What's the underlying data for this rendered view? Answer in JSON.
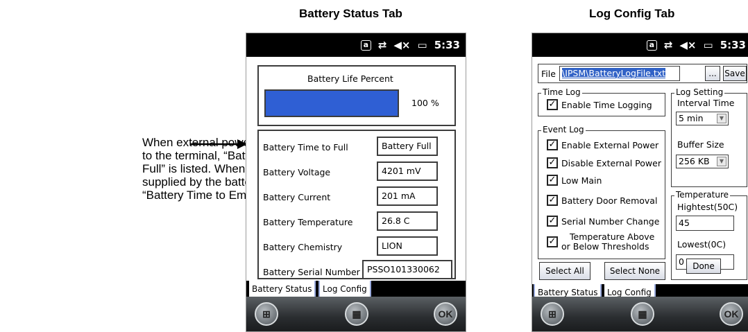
{
  "headings": {
    "battery_tab": "Battery Status Tab",
    "log_tab": "Log Config Tab"
  },
  "annotation": {
    "text": "When external power is supplied to the terminal, “Battery Time to Full” is listed. When power is supplied by the battery pack, “Battery Time to Empty” is listed."
  },
  "statusbar": {
    "time": "5:33",
    "icons": [
      "a-icon",
      "sync-icon",
      "mute-icon",
      "battery-icon"
    ]
  },
  "battery_screen": {
    "life_label": "Battery Life Percent",
    "life_value": "100 %",
    "life_fraction": 1.0,
    "bar_color": "#2f5fd4",
    "rows": [
      {
        "label": "Battery Time to Full",
        "value": "Battery Full"
      },
      {
        "label": "Battery Voltage",
        "value": "4201  mV"
      },
      {
        "label": "Battery Current",
        "value": "201  mA"
      },
      {
        "label": "Battery Temperature",
        "value": "26.8  C"
      },
      {
        "label": "Battery Chemistry",
        "value": "LION"
      },
      {
        "label": "Battery Serial Number",
        "value": "PSSO101330062"
      }
    ]
  },
  "tabs": {
    "battery": "Battery Status",
    "log": "Log Config"
  },
  "taskbar": {
    "ok": "OK"
  },
  "log_screen": {
    "file_label": "File",
    "file_value": "\\IPSM\\BatteryLogFile.txt",
    "browse": "...",
    "save": "Save",
    "time_log": {
      "title": "Time Log",
      "enable": "Enable Time Logging"
    },
    "event_log": {
      "title": "Event Log",
      "items": [
        "Enable External Power",
        "Disable External Power",
        "Low Main",
        "Battery Door Removal",
        "Serial Number Change"
      ],
      "temp_item": [
        "Temperature Above",
        "or Below Thresholds"
      ]
    },
    "log_setting": {
      "title": "Log Setting",
      "interval_label": "Interval Time",
      "interval_value": "5 min",
      "buffer_label": "Buffer Size",
      "buffer_value": "256 KB"
    },
    "temperature": {
      "title": "Temperature",
      "highest_label": "Hightest(50C)",
      "highest_value": "45",
      "lowest_label": "Lowest(0C)",
      "lowest_value": "0",
      "done": "Done"
    },
    "select_all": "Select All",
    "select_none": "Select None"
  }
}
